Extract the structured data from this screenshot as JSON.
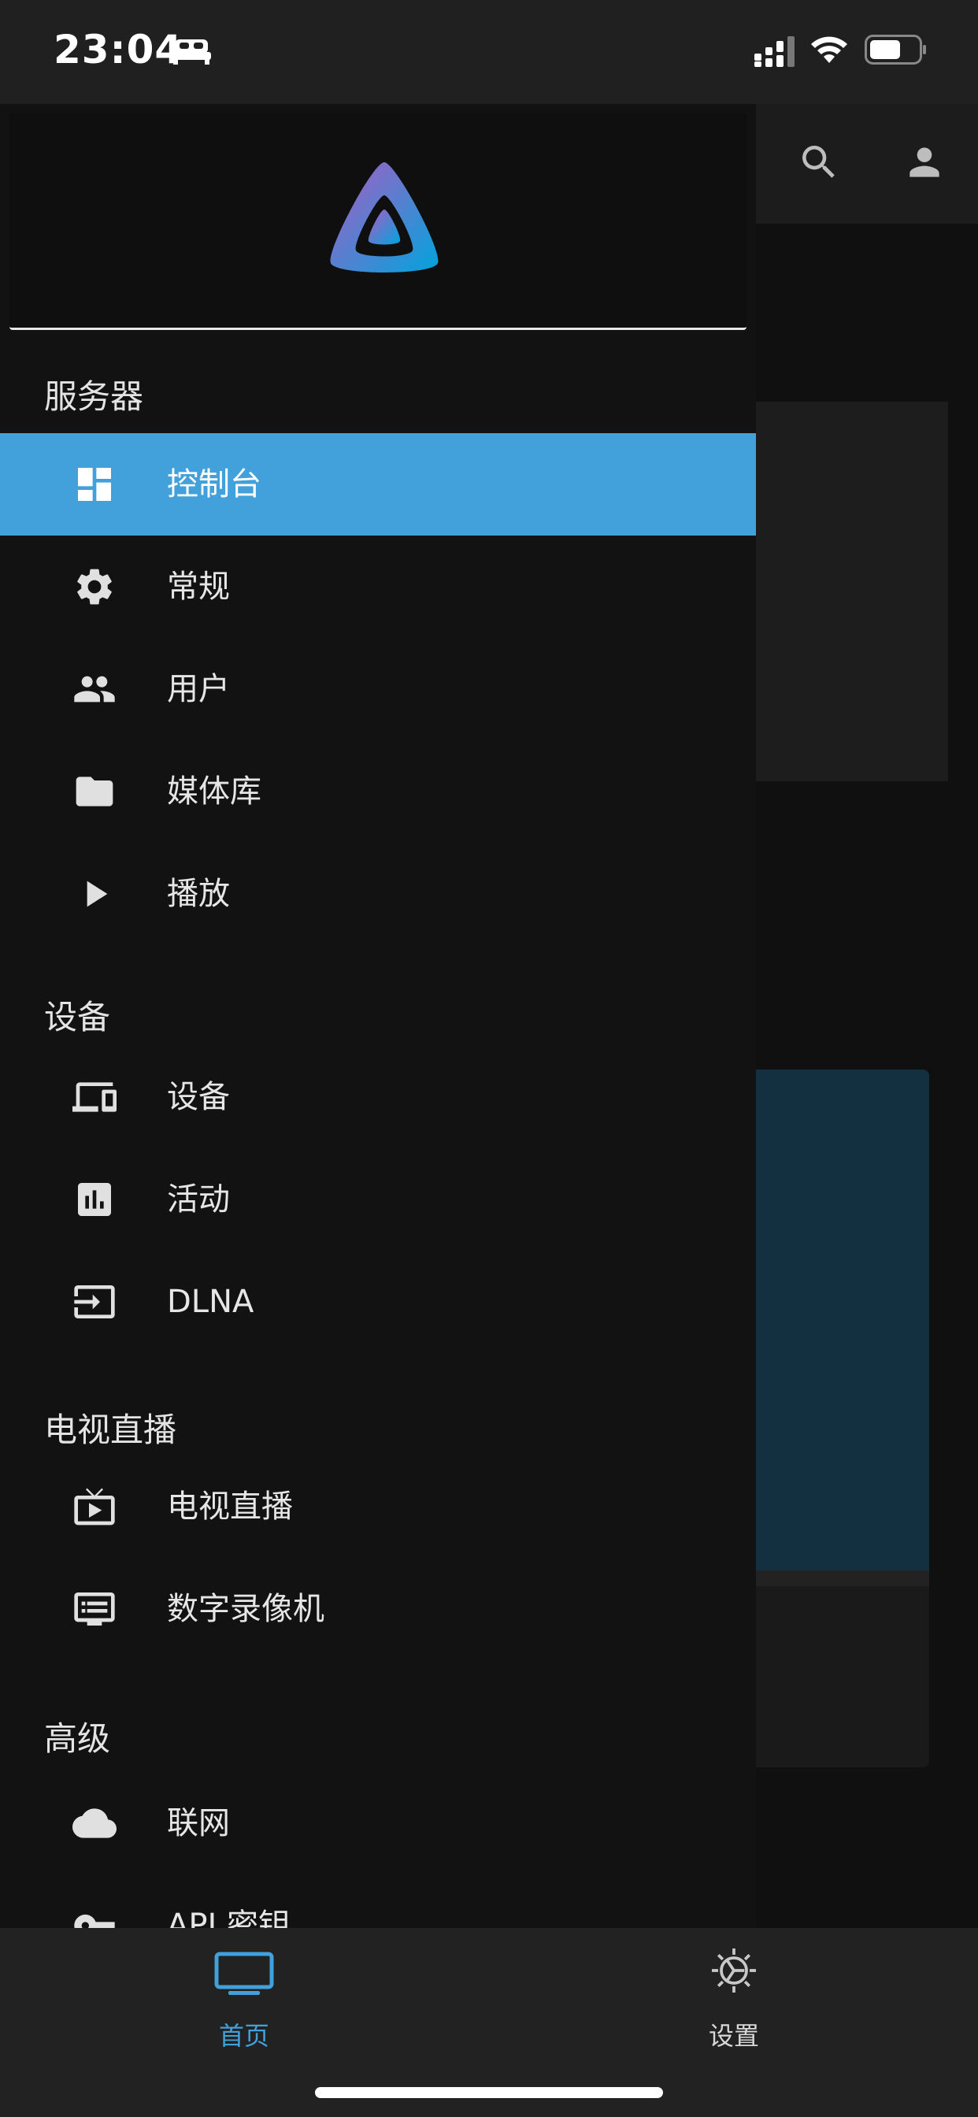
{
  "status_bar": {
    "time": "23:04"
  },
  "drawer": {
    "sections": [
      {
        "title": "服务器",
        "items": [
          {
            "label": "控制台",
            "icon": "dashboard-icon",
            "active": true
          },
          {
            "label": "常规",
            "icon": "gear-icon"
          },
          {
            "label": "用户",
            "icon": "users-icon"
          },
          {
            "label": "媒体库",
            "icon": "folder-icon"
          },
          {
            "label": "播放",
            "icon": "play-icon"
          }
        ]
      },
      {
        "title": "设备",
        "items": [
          {
            "label": "设备",
            "icon": "devices-icon"
          },
          {
            "label": "活动",
            "icon": "activity-chart-icon"
          },
          {
            "label": "DLNA",
            "icon": "input-icon"
          }
        ]
      },
      {
        "title": "电视直播",
        "items": [
          {
            "label": "电视直播",
            "icon": "live-tv-icon"
          },
          {
            "label": "数字录像机",
            "icon": "dvr-icon"
          }
        ]
      },
      {
        "title": "高级",
        "items": [
          {
            "label": "联网",
            "icon": "cloud-icon"
          },
          {
            "label": "API 密钥",
            "icon": "key-icon"
          }
        ]
      }
    ]
  },
  "tab_bar": {
    "tabs": [
      {
        "label": "首页",
        "icon": "tv-icon",
        "active": true
      },
      {
        "label": "设置",
        "icon": "gear-icon"
      }
    ]
  },
  "colors": {
    "accent": "#42a0da",
    "drawer_bg": "#121212",
    "tab_bar_bg": "#222222",
    "status_bar_bg": "#202020"
  }
}
